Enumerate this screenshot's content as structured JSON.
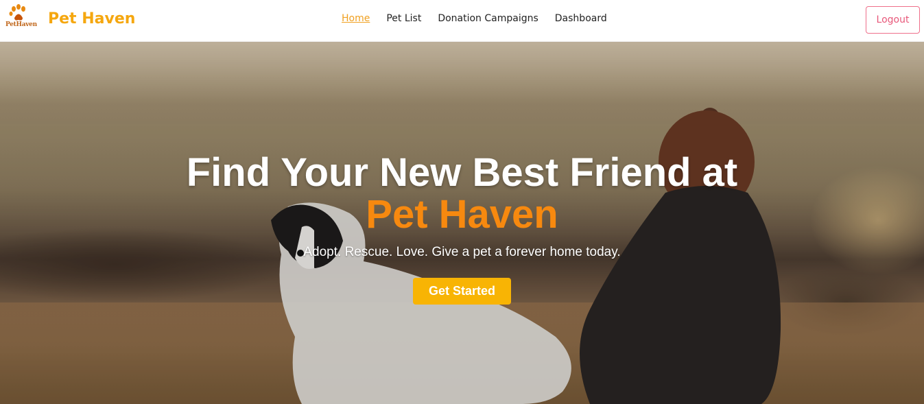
{
  "brand": {
    "logo_text": "PetHaven",
    "name": "Pet Haven"
  },
  "nav": {
    "items": [
      {
        "label": "Home",
        "active": true
      },
      {
        "label": "Pet List",
        "active": false
      },
      {
        "label": "Donation Campaigns",
        "active": false
      },
      {
        "label": "Dashboard",
        "active": false
      }
    ],
    "logout_label": "Logout"
  },
  "hero": {
    "title": "Find Your New Best Friend at",
    "title_highlight": "Pet Haven",
    "subtitle": "Adopt. Rescue. Love. Give a pet a forever home today.",
    "cta_label": "Get Started"
  },
  "colors": {
    "brand": "#f5a70f",
    "highlight": "#f7890f",
    "cta": "#f8b404",
    "logout": "#e8587a"
  },
  "icons": {
    "logo": "paw-print-icon"
  }
}
